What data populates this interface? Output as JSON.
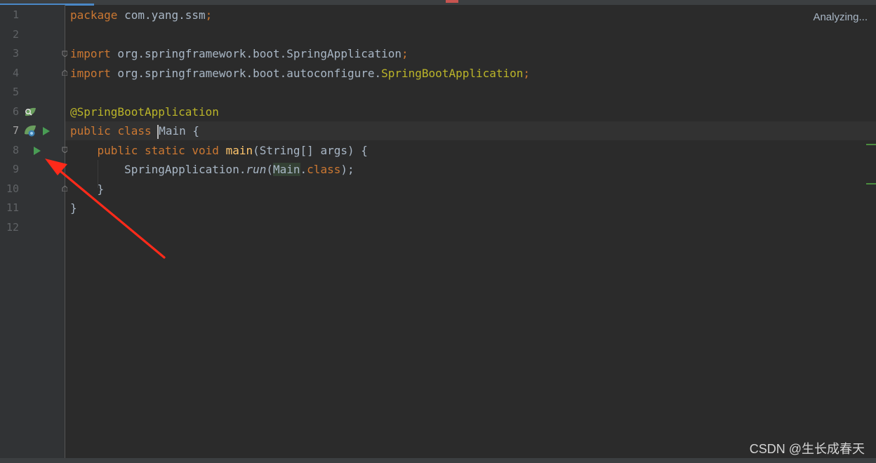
{
  "status": {
    "analyzing": "Analyzing..."
  },
  "watermark": "CSDN @生长成春天",
  "lines": [
    {
      "num": "1"
    },
    {
      "num": "2"
    },
    {
      "num": "3"
    },
    {
      "num": "4"
    },
    {
      "num": "5"
    },
    {
      "num": "6"
    },
    {
      "num": "7"
    },
    {
      "num": "8"
    },
    {
      "num": "9"
    },
    {
      "num": "10"
    },
    {
      "num": "11"
    },
    {
      "num": "12"
    }
  ],
  "code": {
    "l1": {
      "kw": "package",
      "rest": " com.yang.ssm",
      "semi": ";"
    },
    "l3": {
      "kw": "import",
      "rest": " org.springframework.boot.SpringApplication",
      "semi": ";"
    },
    "l4": {
      "kw": "import",
      "rest": " org.springframework.boot.autoconfigure.",
      "cls": "SpringBootApplication",
      "semi": ";"
    },
    "l6": {
      "ann": "@SpringBootApplication"
    },
    "l7": {
      "kw1": "public",
      "kw2": "class",
      "pre": "",
      "name": "Main",
      "rest": " {"
    },
    "l8": {
      "kw1": "public",
      "kw2": "static",
      "kw3": "void",
      "fn": "main",
      "rest": "(String[] args) {"
    },
    "l9": {
      "obj": "SpringApplication.",
      "method": "run",
      "open": "(",
      "arg": "Main",
      "dot": ".",
      "kw": "class",
      "close": ");"
    },
    "l10": {
      "text": "}"
    },
    "l11": {
      "text": "}"
    }
  },
  "icons": {
    "gutter_line6": "spring-bean-find-icon",
    "gutter_line7_spring": "spring-bean-icon",
    "gutter_line7_run": "run-icon",
    "gutter_line8_run": "run-icon",
    "annotation_arrow": "red-arrow-icon"
  },
  "colors": {
    "background": "#2b2b2b",
    "gutter": "#313335",
    "keyword": "#cc7832",
    "annotation": "#bbb529",
    "function": "#ffc66d",
    "text": "#a9b7c6",
    "run": "#499c54",
    "arrow": "#ff2a1a"
  }
}
